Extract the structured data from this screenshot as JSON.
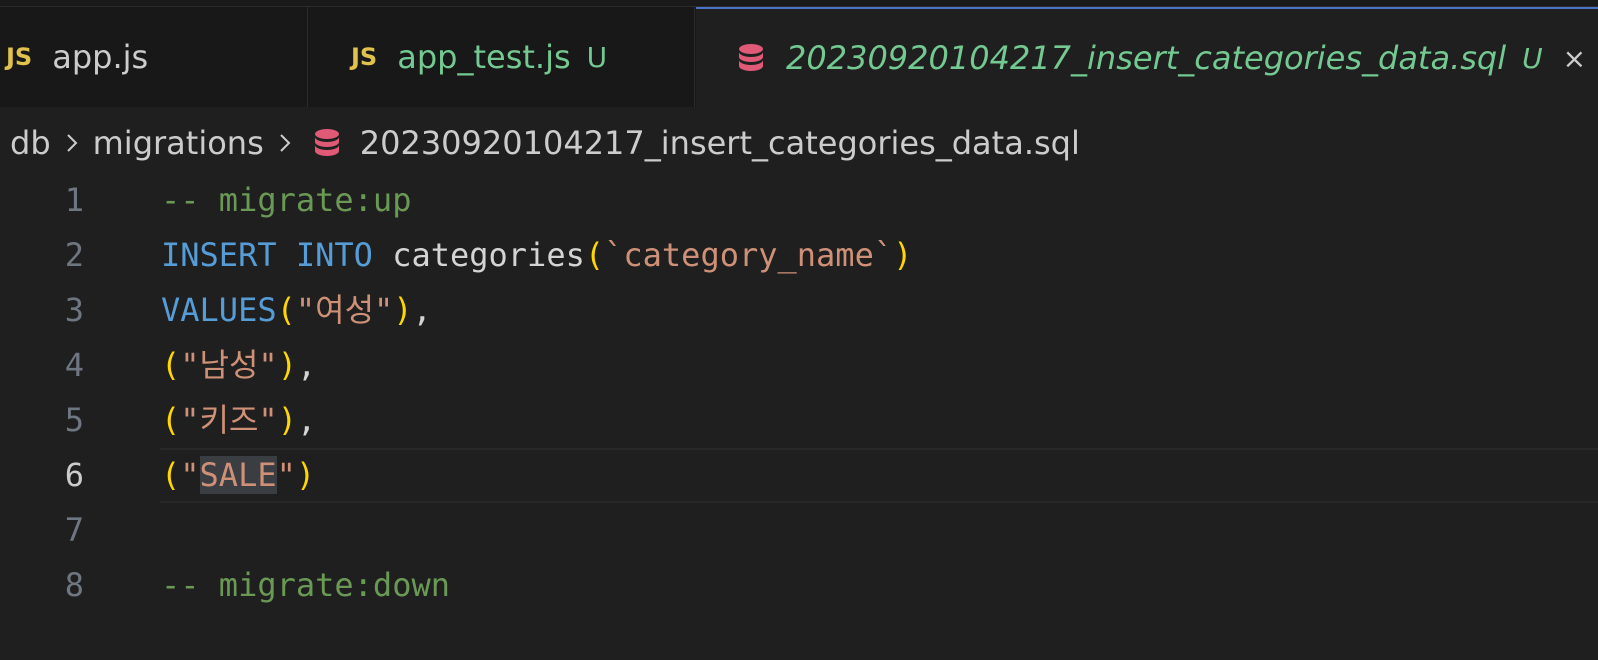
{
  "tabs": [
    {
      "icon": "JS",
      "label": "app.js",
      "status": ""
    },
    {
      "icon": "JS",
      "label": "app_test.js",
      "status": "U"
    },
    {
      "icon": "database-icon",
      "label": "20230920104217_insert_categories_data.sql",
      "status": "U",
      "close": "×"
    }
  ],
  "breadcrumb": {
    "items": [
      "db",
      "migrations",
      "20230920104217_insert_categories_data.sql"
    ]
  },
  "editor": {
    "current_line": 6,
    "lines": [
      {
        "number": "1",
        "tokens": [
          {
            "t": "-- migrate:up",
            "c": "comment"
          }
        ]
      },
      {
        "number": "2",
        "tokens": [
          {
            "t": "INSERT",
            "c": "keyword"
          },
          {
            "t": " ",
            "c": "plain"
          },
          {
            "t": "INTO",
            "c": "keyword"
          },
          {
            "t": " categories",
            "c": "plain"
          },
          {
            "t": "(",
            "c": "paren"
          },
          {
            "t": "`category_name`",
            "c": "string"
          },
          {
            "t": ")",
            "c": "paren"
          }
        ]
      },
      {
        "number": "3",
        "tokens": [
          {
            "t": "VALUES",
            "c": "keyword"
          },
          {
            "t": "(",
            "c": "paren"
          },
          {
            "t": "\"여성\"",
            "c": "string"
          },
          {
            "t": ")",
            "c": "paren"
          },
          {
            "t": ",",
            "c": "punct"
          }
        ]
      },
      {
        "number": "4",
        "tokens": [
          {
            "t": "(",
            "c": "paren"
          },
          {
            "t": "\"남성\"",
            "c": "string"
          },
          {
            "t": ")",
            "c": "paren"
          },
          {
            "t": ",",
            "c": "punct"
          }
        ]
      },
      {
        "number": "5",
        "tokens": [
          {
            "t": "(",
            "c": "paren"
          },
          {
            "t": "\"키즈\"",
            "c": "string"
          },
          {
            "t": ")",
            "c": "paren"
          },
          {
            "t": ",",
            "c": "punct"
          }
        ]
      },
      {
        "number": "6",
        "tokens": [
          {
            "t": "(",
            "c": "paren"
          },
          {
            "t": "\"",
            "c": "string"
          },
          {
            "t": "SALE",
            "c": "string highlight"
          },
          {
            "t": "\"",
            "c": "string"
          },
          {
            "t": ")",
            "c": "paren"
          }
        ]
      },
      {
        "number": "7",
        "tokens": []
      },
      {
        "number": "8",
        "tokens": [
          {
            "t": "-- migrate:down",
            "c": "comment"
          }
        ]
      }
    ]
  },
  "colors": {
    "background": "#1f1f1f",
    "tab_bar": "#181818",
    "active_tab_border": "#4a74c9",
    "untracked": "#73c991",
    "js_icon": "#e0c24c",
    "db_icon": "#e05a78",
    "comment": "#6a9955",
    "keyword": "#569cd6",
    "string": "#ce9178",
    "bracket": "#ffd700"
  }
}
